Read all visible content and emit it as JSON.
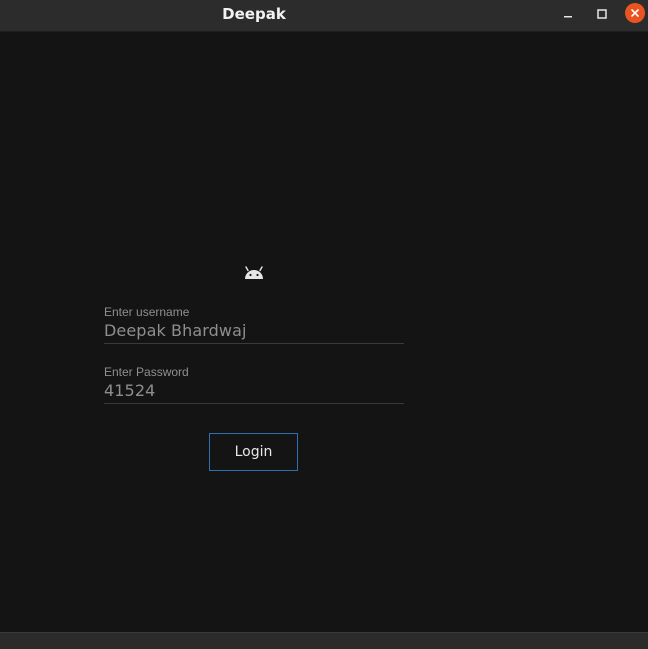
{
  "window": {
    "title": "Deepak",
    "controls": {
      "minimize_icon": "minimize-icon",
      "maximize_icon": "maximize-icon",
      "close_icon": "close-icon",
      "close_color": "#e95420"
    }
  },
  "login_form": {
    "logo_icon": "android-icon",
    "username": {
      "label": "Enter username",
      "value": "Deepak Bhardwaj"
    },
    "password": {
      "label": "Enter Password",
      "value": "41524"
    },
    "login_label": "Login",
    "accent_color": "#2f6fb3"
  }
}
